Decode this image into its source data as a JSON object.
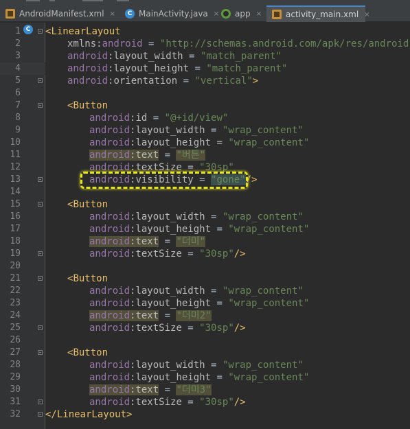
{
  "tabs": [
    {
      "label": "AndroidManifest.xml",
      "icon": "xml-file-icon"
    },
    {
      "label": "MainActivity.java",
      "icon": "class-icon"
    },
    {
      "label": "app",
      "icon": "gradle-app-icon"
    },
    {
      "label": "activity_main.xml",
      "icon": "xml-file-icon",
      "active": true
    }
  ],
  "close_glyph": "×",
  "gutter_marker": "C",
  "line_numbers": [
    "1",
    "2",
    "3",
    "4",
    "5",
    "6",
    "7",
    "8",
    "9",
    "10",
    "11",
    "12",
    "13",
    "14",
    "15",
    "16",
    "17",
    "18",
    "19",
    "20",
    "21",
    "22",
    "23",
    "24",
    "25",
    "26",
    "27",
    "28",
    "29",
    "30",
    "31",
    "32"
  ],
  "code": {
    "l1": {
      "open": "<",
      "tag": "LinearLayout"
    },
    "l2": {
      "attr": "xmlns:",
      "ns": "android",
      "eq": " = ",
      "val": "\"http://schemas.android.com/apk/res/android\""
    },
    "l3": {
      "ns": "android",
      "attr": ":layout_width",
      "eq": " = ",
      "val": "\"match_parent\""
    },
    "l4": {
      "ns": "android",
      "attr": ":layout_height",
      "eq": " = ",
      "val": "\"match_parent\""
    },
    "l5": {
      "ns": "android",
      "attr": ":orientation",
      "eq": " = ",
      "val": "\"vertical\"",
      "close": ">"
    },
    "l7": {
      "open": "<",
      "tag": "Button"
    },
    "l8": {
      "ns": "android",
      "attr": ":id",
      "eq": " = ",
      "val": "\"@+id/view\""
    },
    "l9": {
      "ns": "android",
      "attr": ":layout_width",
      "eq": " = ",
      "val": "\"wrap_content\""
    },
    "l10": {
      "ns": "android",
      "attr": ":layout_height",
      "eq": " = ",
      "val": "\"wrap_content\""
    },
    "l11": {
      "ns": "android",
      "attr": ":text",
      "eq": " = ",
      "val": "\"버튼\""
    },
    "l12": {
      "ns": "android",
      "attr": ":textSize",
      "eq": " = ",
      "val": "\"30sp\""
    },
    "l13": {
      "ns": "android",
      "attr": ":visibility",
      "eq": " = ",
      "val": "\"gone\"",
      "close": "/>"
    },
    "l15": {
      "open": "<",
      "tag": "Button"
    },
    "l16": {
      "ns": "android",
      "attr": ":layout_width",
      "eq": " = ",
      "val": "\"wrap_content\""
    },
    "l17": {
      "ns": "android",
      "attr": ":layout_height",
      "eq": " = ",
      "val": "\"wrap_content\""
    },
    "l18": {
      "ns": "android",
      "attr": ":text",
      "eq": " = ",
      "val": "\"더미\""
    },
    "l19": {
      "ns": "android",
      "attr": ":textSize",
      "eq": " = ",
      "val": "\"30sp\"",
      "close": "/>"
    },
    "l21": {
      "open": "<",
      "tag": "Button"
    },
    "l22": {
      "ns": "android",
      "attr": ":layout_width",
      "eq": " = ",
      "val": "\"wrap_content\""
    },
    "l23": {
      "ns": "android",
      "attr": ":layout_height",
      "eq": " = ",
      "val": "\"wrap_content\""
    },
    "l24": {
      "ns": "android",
      "attr": ":text",
      "eq": " = ",
      "val": "\"더미2\""
    },
    "l25": {
      "ns": "android",
      "attr": ":textSize",
      "eq": " = ",
      "val": "\"30sp\"",
      "close": "/>"
    },
    "l27": {
      "open": "<",
      "tag": "Button"
    },
    "l28": {
      "ns": "android",
      "attr": ":layout_width",
      "eq": " = ",
      "val": "\"wrap_content\""
    },
    "l29": {
      "ns": "android",
      "attr": ":layout_height",
      "eq": " = ",
      "val": "\"wrap_content\""
    },
    "l30": {
      "ns": "android",
      "attr": ":text",
      "eq": " = ",
      "val": "\"더미3\""
    },
    "l31": {
      "ns": "android",
      "attr": ":textSize",
      "eq": " = ",
      "val": "\"30sp\"",
      "close": "/>"
    },
    "l32": {
      "open": "</",
      "tag": "LinearLayout",
      "close": ">"
    }
  },
  "colors": {
    "background": "#2b2b2b",
    "tag": "#e8bf6a",
    "namespace": "#9876aa",
    "attribute": "#bababa",
    "value": "#6a8759",
    "annotation_highlight": "#e6e619"
  }
}
